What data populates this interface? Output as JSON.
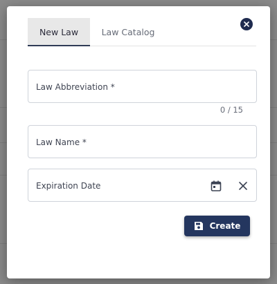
{
  "tabs": {
    "new_law": "New Law",
    "law_catalog": "Law Catalog"
  },
  "form": {
    "abbreviation_label": "Law Abbreviation *",
    "abbreviation_counter": "0 / 15",
    "name_label": "Law Name *",
    "expiration_label": "Expiration Date"
  },
  "actions": {
    "create_label": "Create"
  },
  "icons": {
    "close": "close-icon",
    "calendar": "calendar-icon",
    "clear": "clear-icon",
    "save": "save-icon"
  },
  "colors": {
    "primary": "#24365f",
    "close_button": "#1f2b4f",
    "active_tab_bg": "#e8e8e8"
  }
}
